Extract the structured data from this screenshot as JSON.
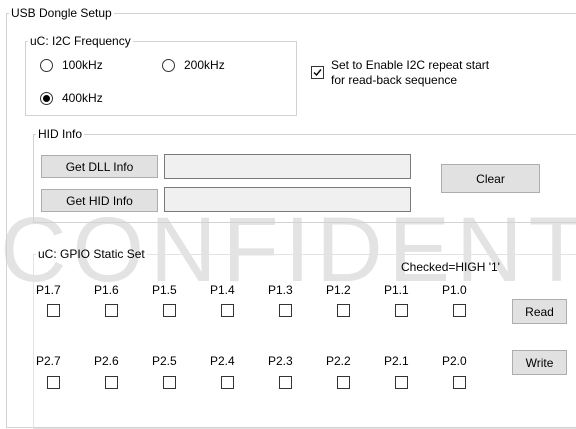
{
  "watermark": "CONFIDENTIAL",
  "main_group": {
    "title": "USB Dongle Setup"
  },
  "i2c": {
    "title": "uC: I2C Frequency",
    "options": [
      {
        "label": "100kHz",
        "checked": false
      },
      {
        "label": "200kHz",
        "checked": false
      },
      {
        "label": "400kHz",
        "checked": true
      }
    ],
    "repeat_start_line1": "Set to Enable I2C repeat start",
    "repeat_start_line2": "for read-back sequence",
    "repeat_start_checked": true
  },
  "hid": {
    "title": "HID Info",
    "get_dll_label": "Get DLL Info",
    "get_hid_label": "Get HID Info",
    "dll_value": "",
    "hid_value": "",
    "clear_label": "Clear"
  },
  "gpio": {
    "title": "uC: GPIO Static Set",
    "note": "Checked=HIGH '1'",
    "port1": [
      "P1.7",
      "P1.6",
      "P1.5",
      "P1.4",
      "P1.3",
      "P1.2",
      "P1.1",
      "P1.0"
    ],
    "port2": [
      "P2.7",
      "P2.6",
      "P2.5",
      "P2.4",
      "P2.3",
      "P2.2",
      "P2.1",
      "P2.0"
    ],
    "read_label": "Read",
    "write_label": "Write"
  },
  "colors": {
    "button_bg": "#e1e1e1",
    "border": "#d2d2d2",
    "watermark": "#e3e3e3"
  }
}
